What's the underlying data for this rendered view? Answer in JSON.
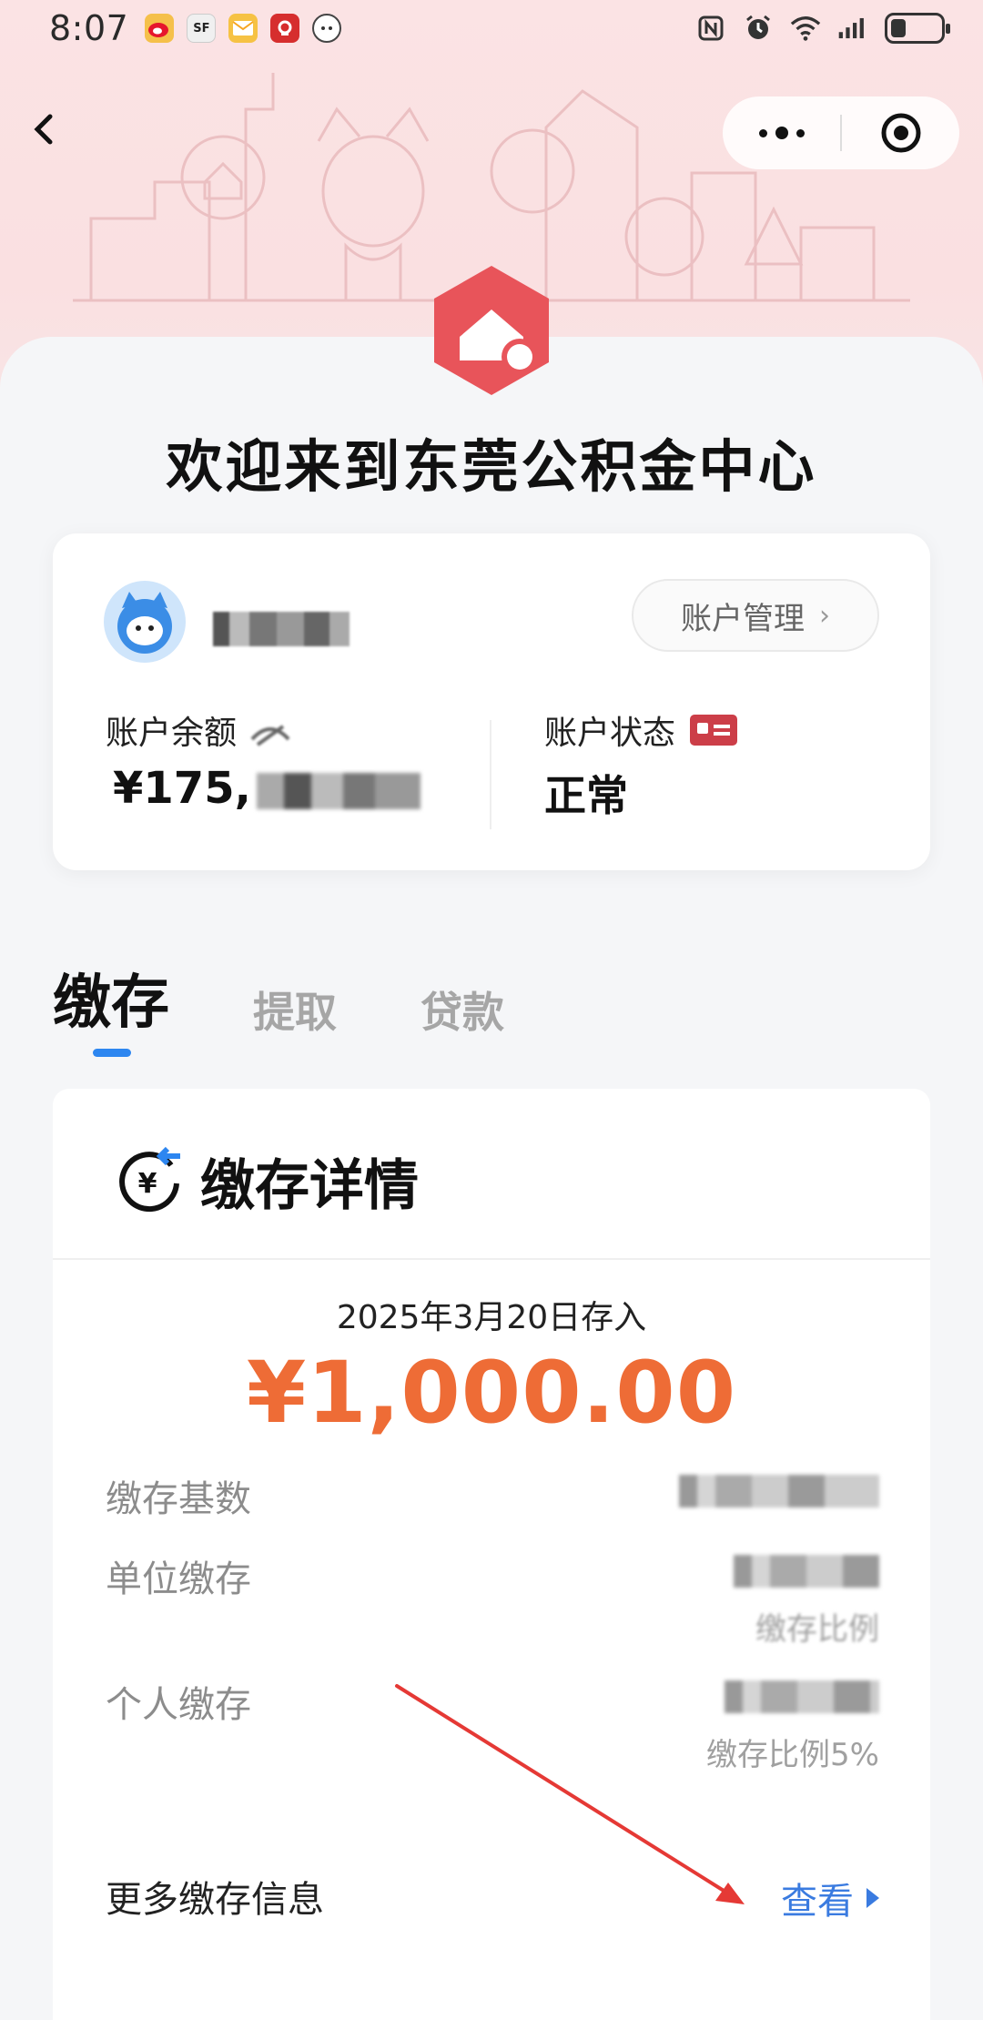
{
  "status_bar": {
    "time": "8:07",
    "apps": [
      {
        "icon": "weibo-icon",
        "color": "#f5a623"
      },
      {
        "icon": "sf-express-icon",
        "color": "#e8e8e8"
      },
      {
        "icon": "mail-icon",
        "color": "#f6c244"
      },
      {
        "icon": "app-red-icon",
        "color": "#d62e2e"
      },
      {
        "icon": "baidu-netdisk-icon",
        "color": "#ffffff"
      }
    ],
    "system_icons": [
      "nfc-icon",
      "alarm-icon",
      "wifi-icon",
      "signal-icon",
      "battery-icon"
    ]
  },
  "nav": {
    "back_icon": "chevron-left-icon",
    "more_icon": "more-dots-icon",
    "close_icon": "target-circle-icon"
  },
  "welcome": "欢迎来到东莞公积金中心",
  "account": {
    "manage_label": "账户管理",
    "balance_label": "账户余额",
    "balance_value": "¥175,",
    "status_label": "账户状态",
    "status_value": "正常"
  },
  "tabs": [
    {
      "label": "缴存",
      "active": true
    },
    {
      "label": "提取",
      "active": false
    },
    {
      "label": "贷款",
      "active": false
    }
  ],
  "detail": {
    "title": "缴存详情",
    "date_text": "2025年3月20日存入",
    "amount": "¥1,000.00",
    "rows": [
      {
        "label": "缴存基数"
      },
      {
        "label": "单位缴存",
        "sub": "缴存比例"
      },
      {
        "label": "个人缴存",
        "sub": "缴存比例5%"
      }
    ],
    "more_label": "更多缴存信息",
    "more_link": "查看"
  },
  "colors": {
    "accent_orange": "#ee6c36",
    "link_blue": "#3a7be0",
    "logo_red": "#e8545a",
    "tab_indicator": "#2d86f0",
    "annotation_red": "#e53935"
  }
}
